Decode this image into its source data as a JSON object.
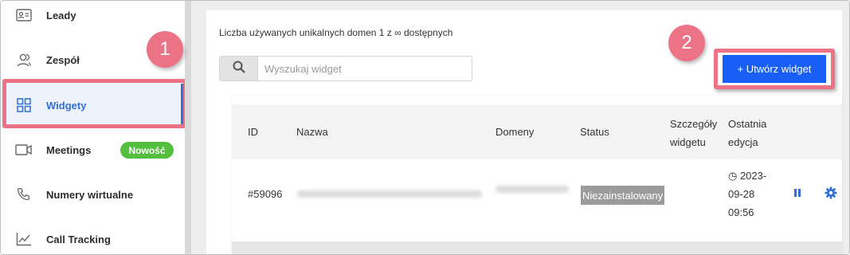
{
  "sidebar": {
    "items": [
      {
        "label": "Leady",
        "icon": "contact-card-icon"
      },
      {
        "label": "Zespół",
        "icon": "team-icon"
      },
      {
        "label": "Widgety",
        "icon": "grid-icon",
        "active": true
      },
      {
        "label": "Meetings",
        "icon": "video-camera-icon"
      },
      {
        "label": "Numery wirtualne",
        "icon": "phone-icon"
      },
      {
        "label": "Call Tracking",
        "icon": "chart-line-icon"
      }
    ],
    "new_badge": "Nowość"
  },
  "annotations": {
    "step1": "1",
    "step2": "2",
    "color": "#ec7385"
  },
  "main": {
    "usage_text": "Liczba używanych unikalnych domen 1 z ∞ dostępnych",
    "search": {
      "placeholder": "Wyszukaj widget",
      "value": ""
    },
    "create_button": "+ Utwórz widget",
    "accent_color": "#1a5ff5"
  },
  "table": {
    "headers": {
      "id": "ID",
      "name": "Nazwa",
      "domains": "Domeny",
      "status": "Status",
      "details_line1": "Szczegóły",
      "details_line2": "widgetu",
      "edit_line1": "Ostatnia",
      "edit_line2": "edycja"
    },
    "rows": [
      {
        "id": "#59096",
        "status": "Niezainstalowany",
        "edit_line1": "◷ 2023-",
        "edit_line2": "09-28",
        "edit_line3": "09:56"
      }
    ]
  }
}
